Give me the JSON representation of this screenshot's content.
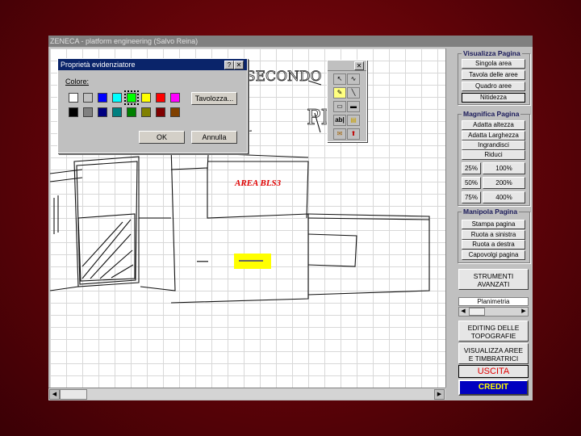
{
  "window": {
    "title": "ZENECA - platform engineering (Salvo Reina)"
  },
  "drawing": {
    "area_label": "AREA BLS3",
    "handwritten_text_1": "SECONDO",
    "handwritten_text_2": "PI"
  },
  "colors": {
    "highlight": "#ffff00",
    "selected_color": "#00ff00"
  },
  "dialog": {
    "title": "Proprietà evidenziatore",
    "help_label": "?",
    "close_label": "✕",
    "color_label": "Colore:",
    "palette_button": "Tavolozza...",
    "ok_button": "OK",
    "cancel_button": "Annulla",
    "swatches": [
      "#ffffff",
      "#c0c0c0",
      "#0000ff",
      "#00ffff",
      "#00ff00",
      "#ffff00",
      "#ff0000",
      "#ff00ff",
      "#000000",
      "#808080",
      "#000080",
      "#008080",
      "#008000",
      "#808000",
      "#800000",
      "#804000"
    ]
  },
  "toolbox": {
    "close_label": "✕"
  },
  "panel": {
    "visualizza": {
      "title": "Visualizza Pagina",
      "buttons": [
        "Singola area",
        "Tavola delle aree",
        "Quadro aree",
        "Nitidezza"
      ]
    },
    "magnifica": {
      "title": "Magnifica Pagina",
      "buttons": [
        "Adatta altezza",
        "Adatta Larghezza",
        "Ingrandisci",
        "Riduci"
      ],
      "zoom": [
        "25%",
        "100%",
        "50%",
        "200%",
        "75%",
        "400%"
      ]
    },
    "manipola": {
      "title": "Manipola Pagina",
      "buttons": [
        "Stampa pagina",
        "Ruota a sinistra",
        "Ruota a destra",
        "Capovolgi pagina"
      ]
    },
    "strumenti_1": "STRUMENTI",
    "strumenti_2": "AVANZATI",
    "planimetria": "Planimetria",
    "editing_1": "EDITING DELLE",
    "editing_2": "TOPOGRAFIE",
    "visualizza_aree_1": "VISUALIZZA AREE",
    "visualizza_aree_2": "E TIMBRATRICI",
    "uscita": "USCITA",
    "credit": "CREDIT"
  }
}
